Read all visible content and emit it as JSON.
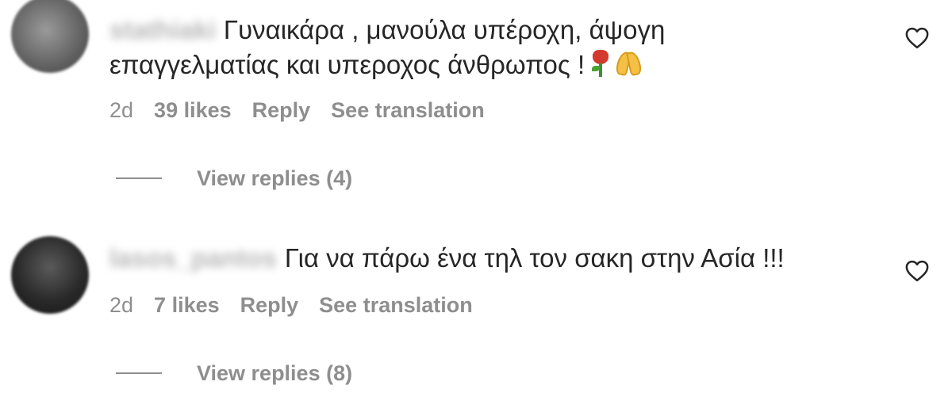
{
  "comments": [
    {
      "username": "stathiaki",
      "text_line1": "Γυναικάρα , μανούλα υπέροχη, άψογη",
      "text_line2": "επαγγελματίας και υπεροχος άνθρωπος !",
      "emojis": [
        "rose-emoji",
        "folded-hands-emoji"
      ],
      "time": "2d",
      "likes": "39 likes",
      "reply_label": "Reply",
      "translate_label": "See translation",
      "view_replies": "View replies (4)"
    },
    {
      "username": "lasos_pantos",
      "text_line1": "Για να πάρω ένα τηλ τον σακη στην Ασία !!!",
      "time": "2d",
      "likes": "7 likes",
      "reply_label": "Reply",
      "translate_label": "See translation",
      "view_replies": "View replies (8)"
    }
  ],
  "icons": {
    "like": "heart-outline-icon"
  },
  "colors": {
    "text": "#262626",
    "secondary": "#8e8e8e",
    "background": "#ffffff"
  }
}
